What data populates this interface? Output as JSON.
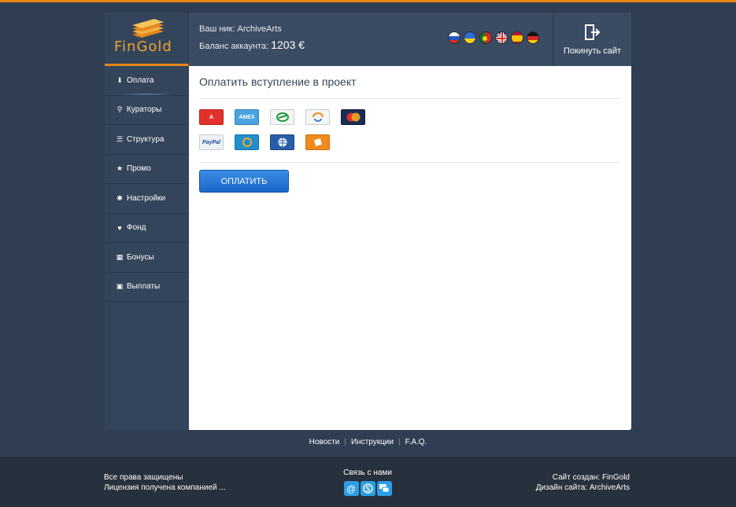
{
  "brand": {
    "logo_text": "FinGold",
    "accent_color": "#e8881a"
  },
  "header": {
    "nick_label": "Ваш ник: ArchiveArts",
    "balance_label": "Баланс аккаунта:",
    "balance_value": "1203 €",
    "logout_label": "Покинуть сайт",
    "languages": [
      "ru",
      "ua",
      "pt",
      "en",
      "es",
      "de"
    ]
  },
  "sidebar": {
    "items": [
      {
        "label": "Оплата",
        "icon": "download-icon",
        "active": true
      },
      {
        "label": "Кураторы",
        "icon": "search-icon"
      },
      {
        "label": "Структура",
        "icon": "list-icon"
      },
      {
        "label": "Промо",
        "icon": "star-icon"
      },
      {
        "label": "Настройки",
        "icon": "gear-icon"
      },
      {
        "label": "Фонд",
        "icon": "heart-icon"
      },
      {
        "label": "Бонусы",
        "icon": "gift-icon"
      },
      {
        "label": "Выплаты",
        "icon": "briefcase-icon"
      }
    ]
  },
  "main": {
    "title": "Оплатить вступление в проект",
    "payment_methods": [
      "alfa-bank",
      "amex",
      "sberbank",
      "liqpay",
      "mastercard",
      "paypal",
      "qiwi",
      "webmoney",
      "yandex-money"
    ],
    "pay_button": "ОПЛАТИТЬ"
  },
  "links": [
    "Новости",
    "Инструкции",
    "F.A.Q."
  ],
  "footer": {
    "rights": "Все права защищены",
    "license": "Лицензия получена компанией ...",
    "contact_title": "Связь с нами",
    "created_by": "Сайт создан: FinGold",
    "designed_by": "Дизайн сайта: ArchiveArts"
  }
}
